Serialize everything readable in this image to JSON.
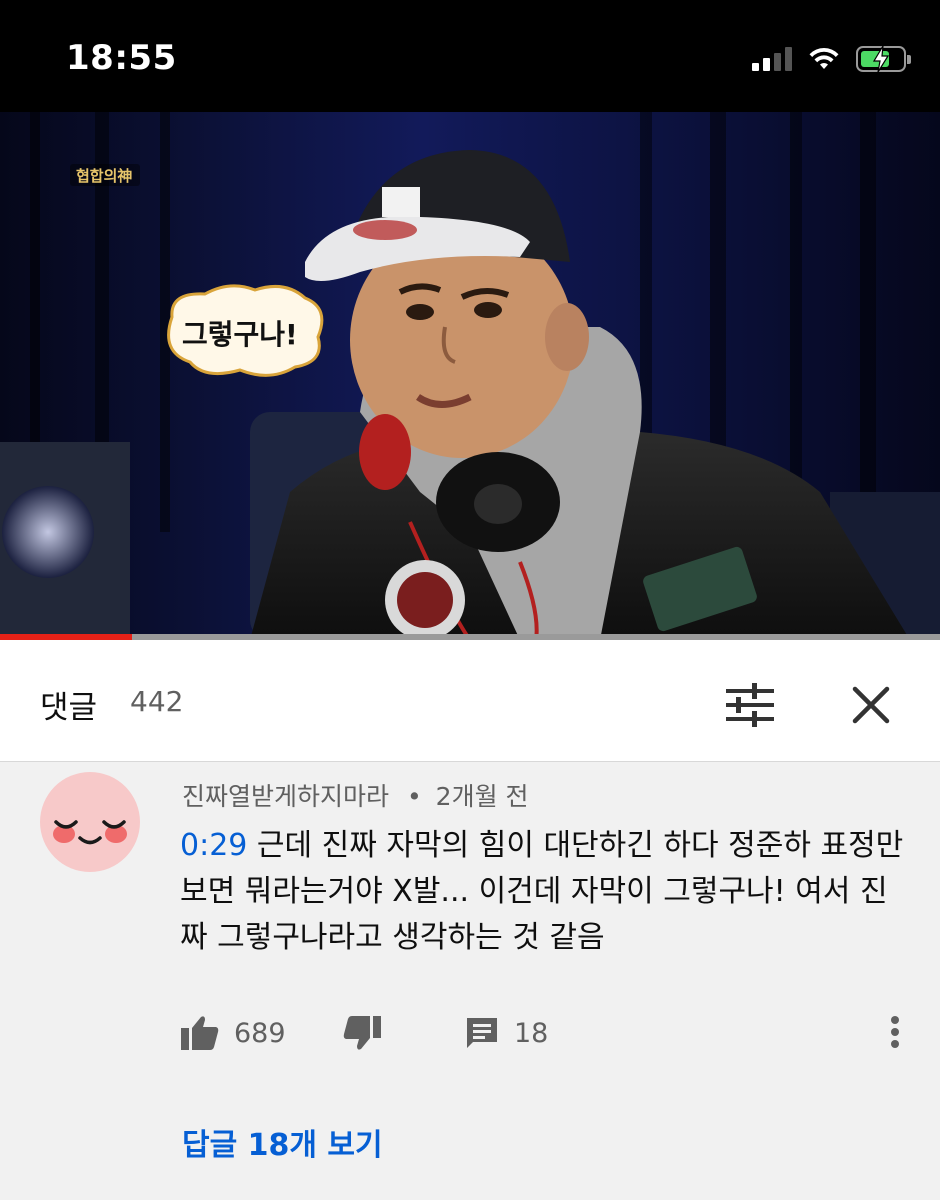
{
  "status_bar": {
    "time": "18:55"
  },
  "video": {
    "caption_bubble": "그렇구나!",
    "channel_logo_text": "협합의神",
    "progress": 0.14
  },
  "comments": {
    "title": "댓글",
    "count": "442"
  },
  "comment": {
    "author": "진짜열받게하지마라",
    "separator": "•",
    "time_ago": "2개월 전",
    "timestamp": "0:29",
    "text": " 근데 진짜 자막의 힘이 대단하긴 하다 정준하 표정만 보면 뭐라는거야 X발... 이건데 자막이 그렇구나! 여서 진짜 그렇구나라고 생각하는 것 같음",
    "like_count": "689",
    "reply_count": "18",
    "view_replies": "답글 18개 보기"
  },
  "colors": {
    "link_blue": "#065fd4",
    "progress_red": "#e62117",
    "avatar_pink": "#f7c9c9"
  },
  "icons": {
    "like": "thumbs-up-icon",
    "dislike": "thumbs-down-icon",
    "reply": "comment-icon",
    "more": "more-vert-icon",
    "sort": "sort-icon",
    "close": "close-icon"
  }
}
